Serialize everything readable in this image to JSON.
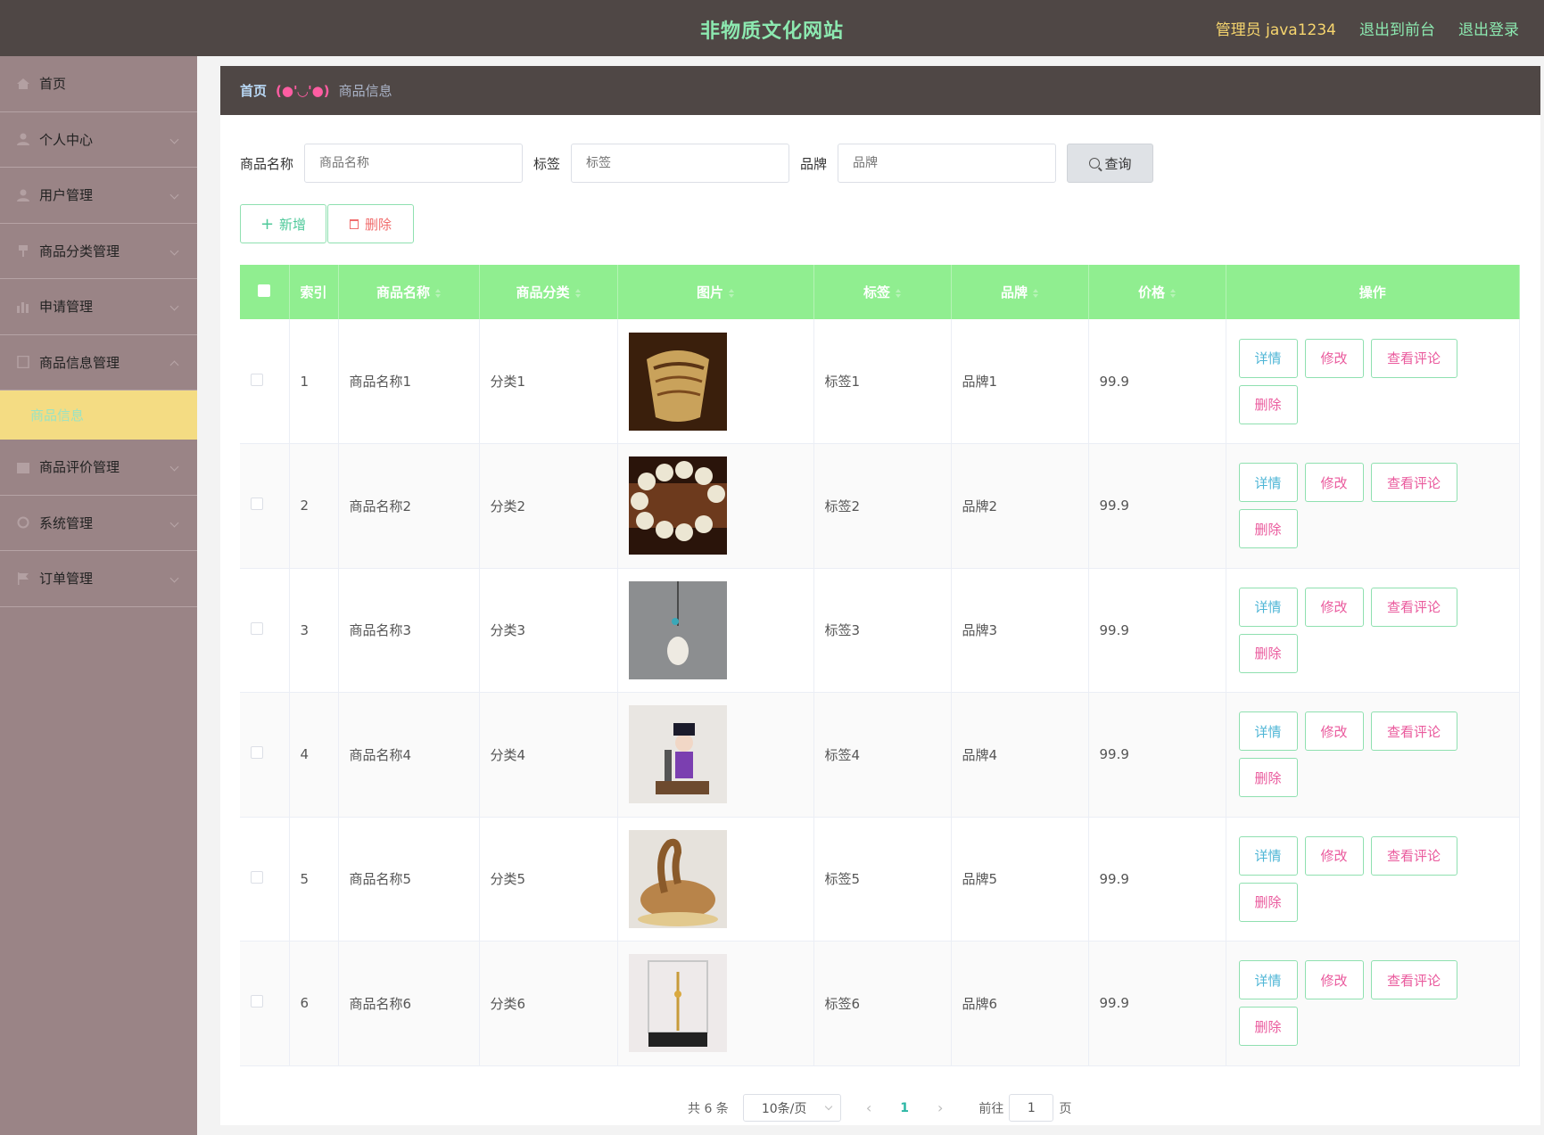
{
  "header": {
    "site_title": "非物质文化网站",
    "admin_label": "管理员 java1234",
    "to_front_label": "退出到前台",
    "logout_label": "退出登录"
  },
  "sidebar": {
    "items": [
      {
        "label": "首页",
        "icon": "home-icon"
      },
      {
        "label": "个人中心",
        "icon": "user-icon"
      },
      {
        "label": "用户管理",
        "icon": "user-icon"
      },
      {
        "label": "商品分类管理",
        "icon": "pin-icon"
      },
      {
        "label": "申请管理",
        "icon": "chart-icon"
      },
      {
        "label": "商品信息管理",
        "icon": "doc-icon"
      },
      {
        "label": "商品评价管理",
        "icon": "calendar-icon"
      },
      {
        "label": "系统管理",
        "icon": "gear-icon"
      },
      {
        "label": "订单管理",
        "icon": "flag-icon"
      }
    ],
    "active_sub": "商品信息"
  },
  "breadcrumb": {
    "home": "首页",
    "separator": "(●'◡'●)",
    "current": "商品信息"
  },
  "search": {
    "name_label": "商品名称",
    "name_placeholder": "商品名称",
    "tag_label": "标签",
    "tag_placeholder": "标签",
    "brand_label": "品牌",
    "brand_placeholder": "品牌",
    "button_label": "查询"
  },
  "actions": {
    "add_label": "新增",
    "delete_label": "删除"
  },
  "table": {
    "columns": [
      "索引",
      "商品名称",
      "商品分类",
      "图片",
      "标签",
      "品牌",
      "价格",
      "操作"
    ],
    "rows": [
      {
        "index": "1",
        "name": "商品名称1",
        "category": "分类1",
        "tag": "标签1",
        "brand": "品牌1",
        "price": "99.9"
      },
      {
        "index": "2",
        "name": "商品名称2",
        "category": "分类2",
        "tag": "标签2",
        "brand": "品牌2",
        "price": "99.9"
      },
      {
        "index": "3",
        "name": "商品名称3",
        "category": "分类3",
        "tag": "标签3",
        "brand": "品牌3",
        "price": "99.9"
      },
      {
        "index": "4",
        "name": "商品名称4",
        "category": "分类4",
        "tag": "标签4",
        "brand": "品牌4",
        "price": "99.9"
      },
      {
        "index": "5",
        "name": "商品名称5",
        "category": "分类5",
        "tag": "标签5",
        "brand": "品牌5",
        "price": "99.9"
      },
      {
        "index": "6",
        "name": "商品名称6",
        "category": "分类6",
        "tag": "标签6",
        "brand": "品牌6",
        "price": "99.9"
      }
    ],
    "op_labels": {
      "detail": "详情",
      "edit": "修改",
      "review": "查看评论",
      "delete": "删除"
    }
  },
  "pagination": {
    "total": "共 6 条",
    "page_size": "10条/页",
    "current_page": "1",
    "goto_label": "前往",
    "goto_value": "1",
    "page_unit": "页"
  },
  "colors": {
    "topbar": "#4f4745",
    "sidebar": "#9a8486",
    "table_header": "#90ee90",
    "title_green": "#8ce9b0",
    "admin_yellow": "#f6d56e",
    "active_sub_bg": "#f4dc83"
  }
}
